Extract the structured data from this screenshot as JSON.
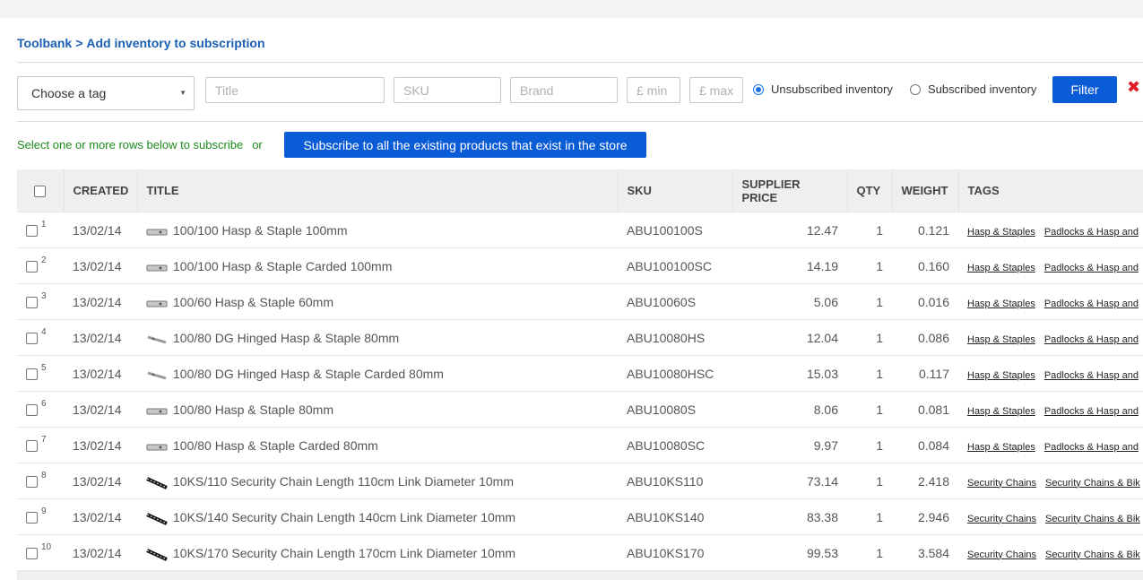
{
  "breadcrumb": {
    "parent": "Toolbank",
    "separator": ">",
    "current": "Add inventory to subscription"
  },
  "filters": {
    "tag_select": "Choose a tag",
    "title_placeholder": "Title",
    "sku_placeholder": "SKU",
    "brand_placeholder": "Brand",
    "min_placeholder": "£ min",
    "max_placeholder": "£ max",
    "radio_unsubscribed": "Unsubscribed inventory",
    "radio_subscribed": "Subscribed inventory",
    "filter_button": "Filter"
  },
  "hint": {
    "text": "Select one or more rows below to subscribe",
    "or": "or",
    "subscribe_all_button": "Subscribe to all the existing products that exist in the store"
  },
  "table": {
    "headers": {
      "created": "CREATED",
      "title": "TITLE",
      "sku": "SKU",
      "supplier_price": "SUPPLIER PRICE",
      "qty": "QTY",
      "weight": "WEIGHT",
      "tags": "TAGS"
    },
    "rows": [
      {
        "index": "1",
        "created": "13/02/14",
        "title": "100/100 Hasp & Staple 100mm",
        "sku": "ABU100100S",
        "price": "12.47",
        "qty": "1",
        "weight": "0.121",
        "tag1": "Hasp & Staples",
        "tag2": "Padlocks & Hasp and",
        "thumb": "hasp"
      },
      {
        "index": "2",
        "created": "13/02/14",
        "title": "100/100 Hasp & Staple Carded 100mm",
        "sku": "ABU100100SC",
        "price": "14.19",
        "qty": "1",
        "weight": "0.160",
        "tag1": "Hasp & Staples",
        "tag2": "Padlocks & Hasp and",
        "thumb": "hasp"
      },
      {
        "index": "3",
        "created": "13/02/14",
        "title": "100/60 Hasp & Staple 60mm",
        "sku": "ABU10060S",
        "price": "5.06",
        "qty": "1",
        "weight": "0.016",
        "tag1": "Hasp & Staples",
        "tag2": "Padlocks & Hasp and",
        "thumb": "hasp"
      },
      {
        "index": "4",
        "created": "13/02/14",
        "title": "100/80 DG Hinged Hasp & Staple 80mm",
        "sku": "ABU10080HS",
        "price": "12.04",
        "qty": "1",
        "weight": "0.086",
        "tag1": "Hasp & Staples",
        "tag2": "Padlocks & Hasp and",
        "thumb": "hinged"
      },
      {
        "index": "5",
        "created": "13/02/14",
        "title": "100/80 DG Hinged Hasp & Staple Carded 80mm",
        "sku": "ABU10080HSC",
        "price": "15.03",
        "qty": "1",
        "weight": "0.117",
        "tag1": "Hasp & Staples",
        "tag2": "Padlocks & Hasp and",
        "thumb": "hinged"
      },
      {
        "index": "6",
        "created": "13/02/14",
        "title": "100/80 Hasp & Staple 80mm",
        "sku": "ABU10080S",
        "price": "8.06",
        "qty": "1",
        "weight": "0.081",
        "tag1": "Hasp & Staples",
        "tag2": "Padlocks & Hasp and",
        "thumb": "hasp"
      },
      {
        "index": "7",
        "created": "13/02/14",
        "title": "100/80 Hasp & Staple Carded 80mm",
        "sku": "ABU10080SC",
        "price": "9.97",
        "qty": "1",
        "weight": "0.084",
        "tag1": "Hasp & Staples",
        "tag2": "Padlocks & Hasp and",
        "thumb": "hasp"
      },
      {
        "index": "8",
        "created": "13/02/14",
        "title": "10KS/110 Security Chain Length 110cm Link Diameter 10mm",
        "sku": "ABU10KS110",
        "price": "73.14",
        "qty": "1",
        "weight": "2.418",
        "tag1": "Security Chains",
        "tag2": "Security Chains & Bik",
        "thumb": "chain"
      },
      {
        "index": "9",
        "created": "13/02/14",
        "title": "10KS/140 Security Chain Length 140cm Link Diameter 10mm",
        "sku": "ABU10KS140",
        "price": "83.38",
        "qty": "1",
        "weight": "2.946",
        "tag1": "Security Chains",
        "tag2": "Security Chains & Bik",
        "thumb": "chain"
      },
      {
        "index": "10",
        "created": "13/02/14",
        "title": "10KS/170 Security Chain Length 170cm Link Diameter 10mm",
        "sku": "ABU10KS170",
        "price": "99.53",
        "qty": "1",
        "weight": "3.584",
        "tag1": "Security Chains",
        "tag2": "Security Chains & Bik",
        "thumb": "chain"
      }
    ]
  },
  "colors": {
    "accent": "#0a5bd6",
    "link": "#1a5fb4",
    "hint_green": "#1d8a1d",
    "clear_red": "#e01b24"
  }
}
